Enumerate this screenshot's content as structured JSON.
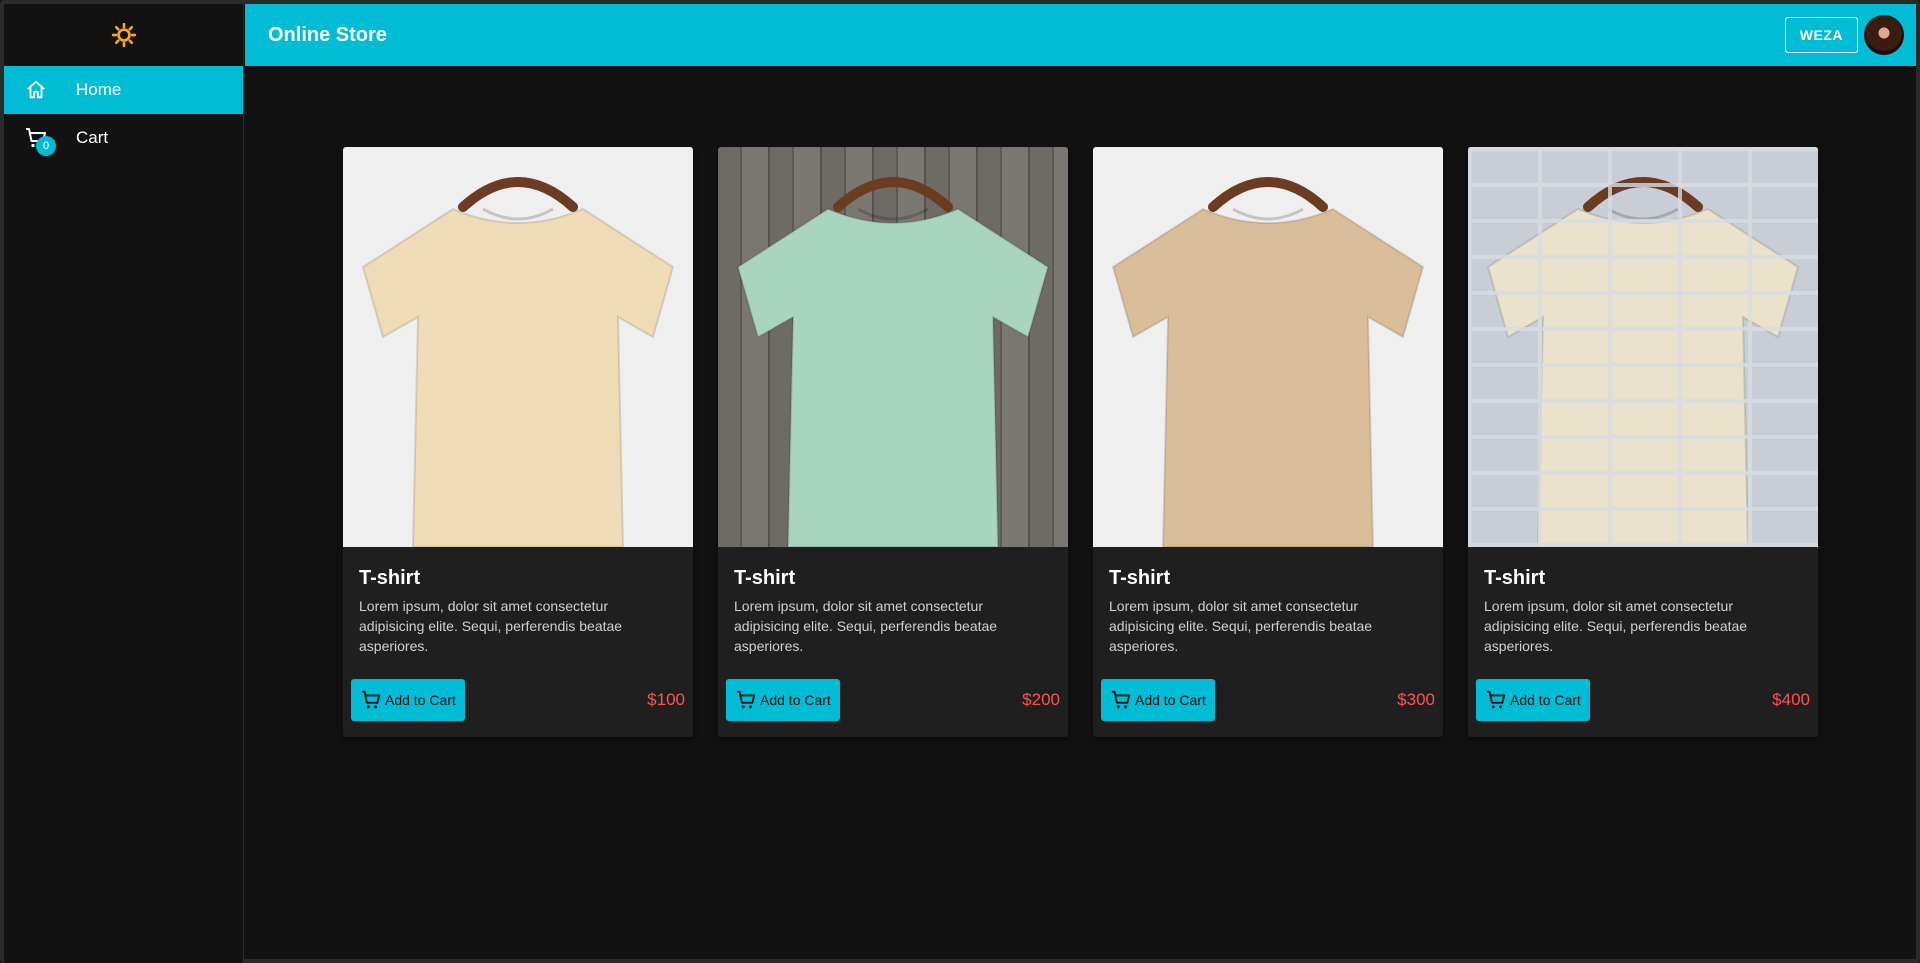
{
  "app": {
    "title": "Online Store"
  },
  "sidebar": {
    "items": [
      {
        "label": "Home",
        "icon": "home-icon",
        "active": true
      },
      {
        "label": "Cart",
        "icon": "cart-icon",
        "badge": "0"
      }
    ]
  },
  "header": {
    "user_label": "WEZA"
  },
  "products": [
    {
      "title": "T-shirt",
      "description": "Lorem ipsum, dolor sit amet consectetur adipisicing elite. Sequi, perferendis beatae asperiores.",
      "button": "Add to Cart",
      "price": "$100",
      "shirt_color": "#efdcb6",
      "background": "plain"
    },
    {
      "title": "T-shirt",
      "description": "Lorem ipsum, dolor sit amet consectetur adipisicing elite. Sequi, perferendis beatae asperiores.",
      "button": "Add to Cart",
      "price": "$200",
      "shirt_color": "#a9d4c0",
      "background": "wood"
    },
    {
      "title": "T-shirt",
      "description": "Lorem ipsum, dolor sit amet consectetur adipisicing elite. Sequi, perferendis beatae asperiores.",
      "button": "Add to Cart",
      "price": "$300",
      "shirt_color": "#d8bd98",
      "background": "plain"
    },
    {
      "title": "T-shirt",
      "description": "Lorem ipsum, dolor sit amet consectetur adipisicing elite. Sequi, perferendis beatae asperiores.",
      "button": "Add to Cart",
      "price": "$400",
      "shirt_color": "#ebe2cc",
      "background": "brick"
    }
  ],
  "colors": {
    "accent": "#00bcd4",
    "price": "#ff5252",
    "theme_icon": "#f5a623"
  }
}
